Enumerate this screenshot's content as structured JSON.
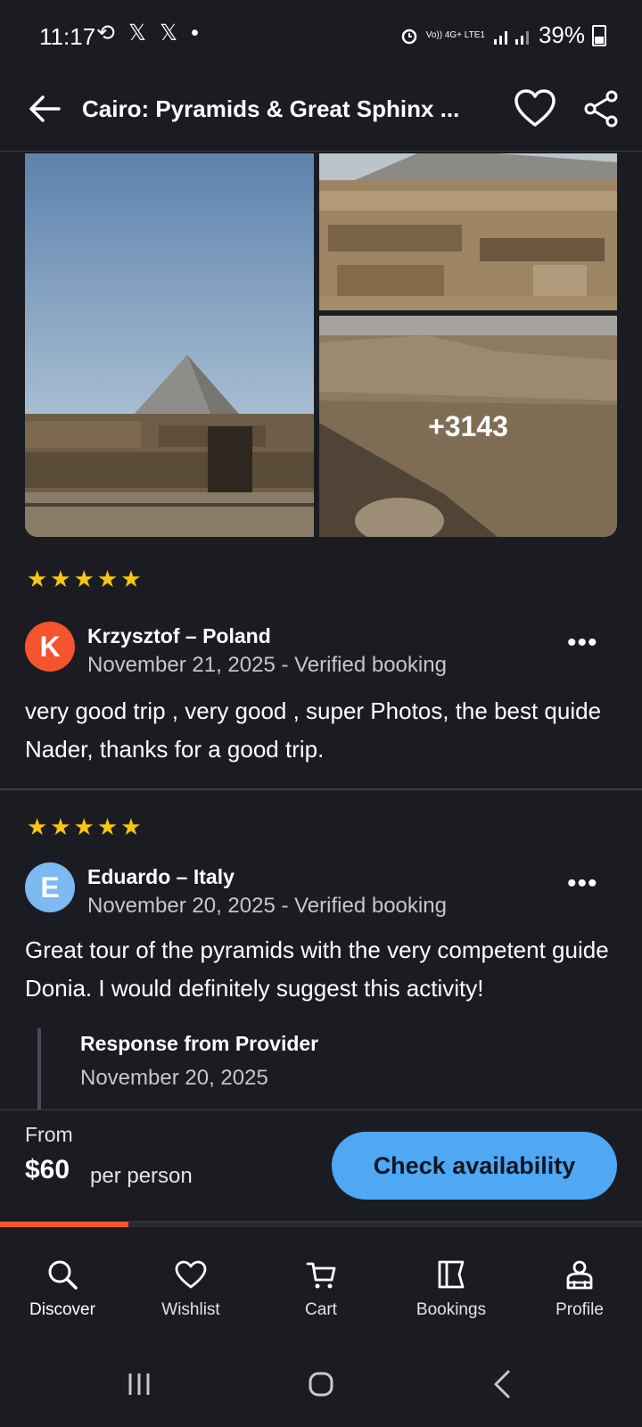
{
  "status_bar": {
    "time": "11:17",
    "notifications": "⟲ 𝕏 𝕏 •",
    "network": "Vo)) 4G+ LTE1",
    "battery": "39%"
  },
  "app_bar": {
    "title": "Cairo: Pyramids & Great Sphinx ..."
  },
  "gallery": {
    "more_count": "+3143"
  },
  "reviews": [
    {
      "stars": "★★★★★",
      "rating": 5,
      "avatar_letter": "K",
      "avatar_color": "#f4542e",
      "name": "Krzysztof – Poland",
      "meta": "November 21, 2025 - Verified booking",
      "more": "•••",
      "text": "very good trip , very good , super Photos, the best quide Nader, thanks for a good trip."
    },
    {
      "stars": "★★★★★",
      "rating": 5,
      "avatar_letter": "E",
      "avatar_color": "#7db9f2",
      "name": "Eduardo – Italy",
      "meta": "November 20, 2025 - Verified booking",
      "more": "•••",
      "text": "Great tour of the pyramids with the very competent guide Donia. I would definitely suggest this activity!",
      "response": {
        "title": "Response from Provider",
        "date": "November 20, 2025"
      }
    }
  ],
  "booking_bar": {
    "from_label": "From",
    "price": "$60",
    "per_person": "per person",
    "cta_label": "Check availability"
  },
  "tabs": [
    {
      "label": "Discover",
      "icon": "search-icon",
      "active": true
    },
    {
      "label": "Wishlist",
      "icon": "heart-icon"
    },
    {
      "label": "Cart",
      "icon": "cart-icon"
    },
    {
      "label": "Bookings",
      "icon": "bookings-icon"
    },
    {
      "label": "Profile",
      "icon": "profile-icon"
    }
  ],
  "colors": {
    "background": "#1b1c21",
    "accent": "#4ea8f4",
    "star": "#f9c513",
    "progress": "#ff5533"
  }
}
